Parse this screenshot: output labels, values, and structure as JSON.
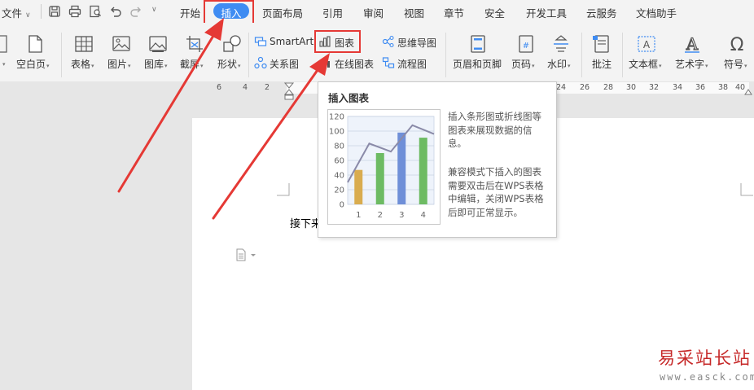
{
  "menubar": {
    "file": "文件",
    "tabs": [
      "开始",
      "插入",
      "页面布局",
      "引用",
      "审阅",
      "视图",
      "章节",
      "安全",
      "开发工具",
      "云服务",
      "文档助手"
    ],
    "active_tab": "插入",
    "accent": "#3f8cf2"
  },
  "toolbar": {
    "blank_page": "空白页",
    "table": "表格",
    "picture": "图片",
    "gallery": "图库",
    "screenshot": "截屏",
    "shapes": "形状",
    "smartart": "SmartArt",
    "chart": "图表",
    "mindmap": "思维导图",
    "relation": "关系图",
    "online_chart": "在线图表",
    "flowchart": "流程图",
    "header_footer": "页眉和页脚",
    "page_number": "页码",
    "watermark": "水印",
    "comment": "批注",
    "textbox": "文本框",
    "wordart": "艺术字",
    "symbol": "符号"
  },
  "ruler": {
    "left_numbers": [
      "6",
      "4",
      "2"
    ],
    "right_numbers": [
      "24",
      "26",
      "28",
      "30",
      "32",
      "34",
      "36",
      "38",
      "40"
    ]
  },
  "document": {
    "body_text": "接下来"
  },
  "tooltip": {
    "title": "插入图表",
    "description": "插入条形图或折线图等图表来展现数据的信息。",
    "compat_note": "兼容模式下插入的图表需要双击后在WPS表格中编辑，关闭WPS表格后即可正常显示。"
  },
  "chart_data": {
    "type": "bar",
    "categories": [
      "1",
      "2",
      "3",
      "4"
    ],
    "values": [
      47,
      70,
      98,
      91
    ],
    "line_values": [
      30,
      83,
      72,
      108,
      96
    ],
    "bar_colors": [
      "#d9ac4f",
      "#6dbb63",
      "#6f8fd8",
      "#6dbb63"
    ],
    "line_color": "#8a8aa8",
    "ylim": [
      0,
      120
    ],
    "yticks": [
      "0",
      "20",
      "40",
      "60",
      "80",
      "100",
      "120"
    ],
    "xlabel": "",
    "ylabel": "",
    "grid": true
  },
  "watermark": {
    "site_name": "易采站长站",
    "site_url": "www.easck.com"
  },
  "annotation_color": "#e53935"
}
